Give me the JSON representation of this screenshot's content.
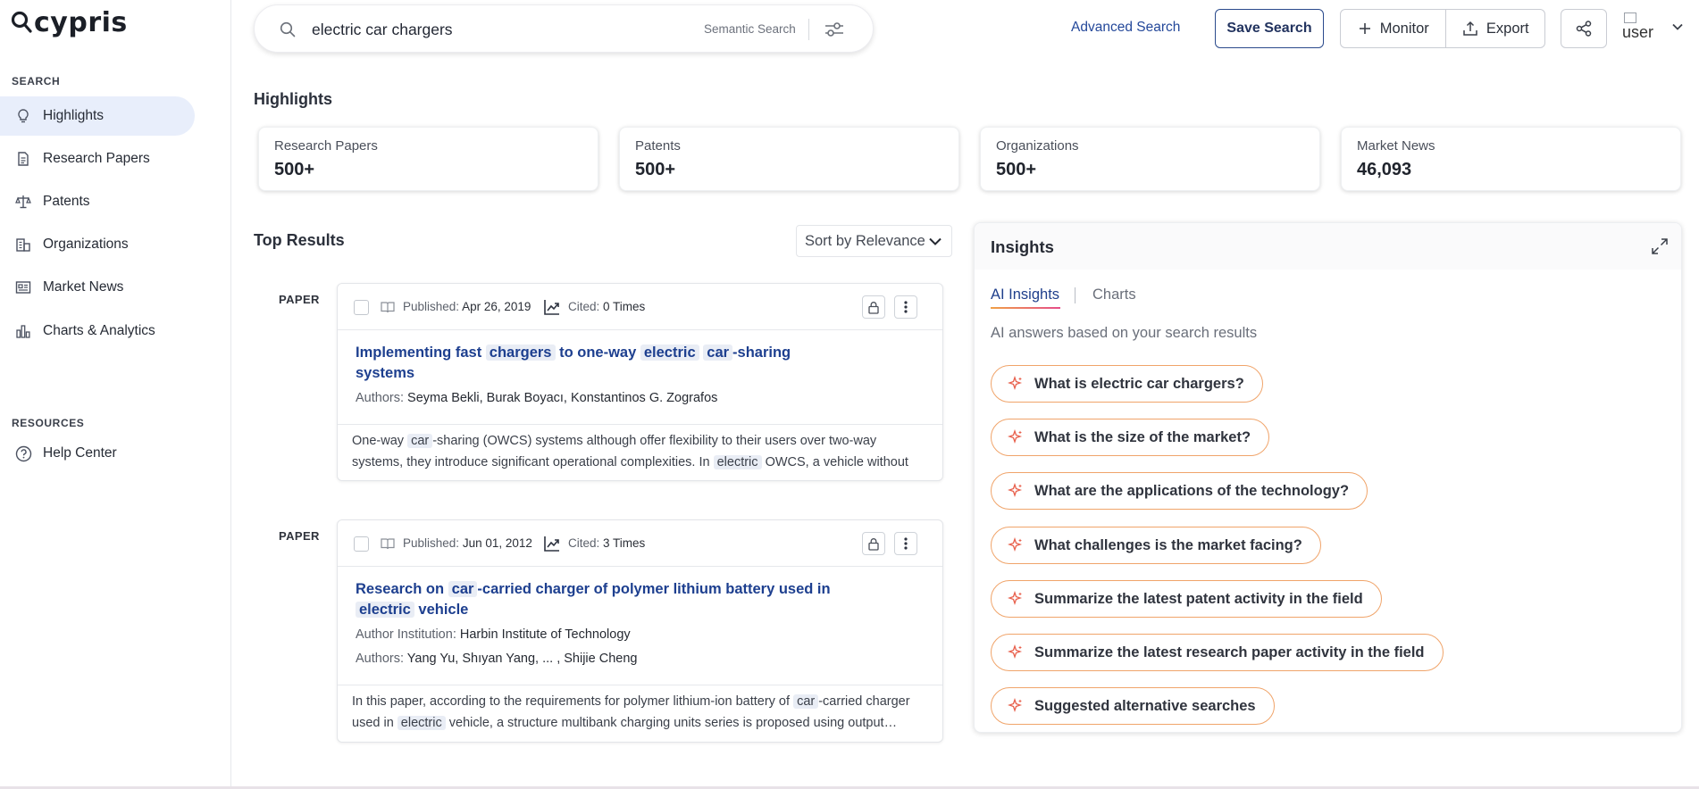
{
  "app": {
    "logo_text": "cypris"
  },
  "sidebar": {
    "search_label": "SEARCH",
    "items": [
      {
        "label": "Highlights",
        "icon": "lightbulb-icon",
        "active": true
      },
      {
        "label": "Research Papers",
        "icon": "document-icon"
      },
      {
        "label": "Patents",
        "icon": "scales-icon"
      },
      {
        "label": "Organizations",
        "icon": "building-icon"
      },
      {
        "label": "Market News",
        "icon": "newspaper-icon"
      },
      {
        "label": "Charts & Analytics",
        "icon": "bar-chart-icon"
      }
    ],
    "resources_label": "RESOURCES",
    "resources": [
      {
        "label": "Help Center",
        "icon": "help-circle-icon"
      }
    ]
  },
  "search": {
    "query": "electric car chargers",
    "mode_label": "Semantic Search",
    "advanced_label": "Advanced Search"
  },
  "toolbar": {
    "save_label": "Save Search",
    "monitor_label": "Monitor",
    "export_label": "Export",
    "avatar_alt": "user"
  },
  "highlights": {
    "title": "Highlights",
    "cards": [
      {
        "label": "Research Papers",
        "value": "500+"
      },
      {
        "label": "Patents",
        "value": "500+"
      },
      {
        "label": "Organizations",
        "value": "500+"
      },
      {
        "label": "Market News",
        "value": "46,093"
      }
    ]
  },
  "results": {
    "title": "Top Results",
    "sort_label": "Sort by Relevance",
    "items": [
      {
        "type": "PAPER",
        "published_label": "Published:",
        "published": "Apr 26, 2019",
        "cited_label": "Cited:",
        "cited": "0 Times",
        "title_parts": [
          "Implementing fast",
          "chargers",
          "to one-way",
          "electric",
          "car",
          "-sharing",
          "systems"
        ],
        "authors_label": "Authors:",
        "authors": "Seyma Bekli, Burak Boyacı, Konstantinos G. Zografos",
        "snippet_parts": [
          "One-way",
          "car",
          "-sharing (OWCS) systems although offer flexibility to their users over two-way systems, they introduce significant operational complexities. In",
          "electric",
          "OWCS, a vehicle without sufficient…"
        ]
      },
      {
        "type": "PAPER",
        "published_label": "Published:",
        "published": "Jun 01, 2012",
        "cited_label": "Cited:",
        "cited": "3 Times",
        "title_parts": [
          "Research on",
          "car",
          "-carried charger of polymer lithium battery used in",
          "electric",
          "vehicle"
        ],
        "institution_label": "Author Institution:",
        "institution": "Harbin Institute of Technology",
        "authors_label": "Authors:",
        "authors": "Yang Yu, Shıyan Yang, ... , Shijie Cheng",
        "snippet_parts": [
          "In this paper, according to the requirements for polymer lithium-ion battery of",
          "car",
          "-carried charger used in",
          "electric",
          "vehicle, a structure multibank charging units series is proposed using output…"
        ]
      }
    ]
  },
  "insights": {
    "title": "Insights",
    "tabs": [
      "AI Insights",
      "Charts"
    ],
    "subtitle": "AI answers based on your search results",
    "questions": [
      "What is electric car chargers?",
      "What is the size of the market?",
      "What are the applications of the technology?",
      "What challenges is the market facing?",
      "Summarize the latest patent activity in the field",
      "Summarize the latest research paper activity in the field",
      "Suggested alternative searches"
    ]
  },
  "colors": {
    "accent": "#1d3f8f",
    "chip_border_start": "#f0a046",
    "chip_border_end": "#e64d8a",
    "active_nav": "#e8eefb"
  }
}
